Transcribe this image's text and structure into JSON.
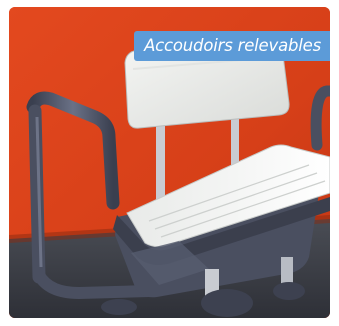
{
  "photo": {
    "subject": "shower-chair-with-folding-armrests",
    "caption": "Accoudoirs relevables",
    "colors": {
      "wall": "#d9401a",
      "floor": "#3c3f46",
      "seat_top": "#eef0ee",
      "frame": "#4a4f60",
      "badge": "#5c9bd8"
    }
  }
}
